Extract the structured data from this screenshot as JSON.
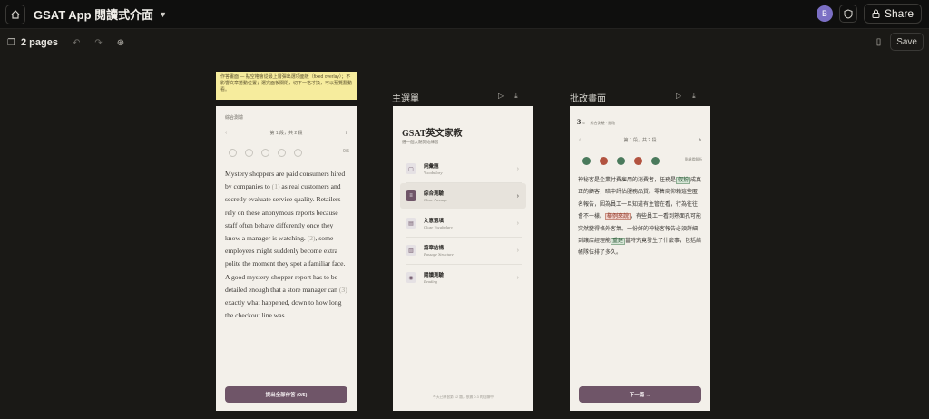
{
  "topbar": {
    "app_title": "GSAT App 閱讀式介面",
    "avatar_initial": "B",
    "share_label": "Share"
  },
  "toolbar": {
    "pages_label": "2 pages",
    "save_label": "Save"
  },
  "sticky_note": {
    "text": "作答畫面 — 點空格會從最上層彈出選項面板（fixed overlay）；不影響文章捲動位置；選完面板關閉，切下一格才換，可以預覽翻動看。"
  },
  "frames": [
    {
      "label": "主選單"
    },
    {
      "label": "批改畫面"
    }
  ],
  "answer_screen": {
    "top_label": "綜合測驗",
    "pager_text": "第 1 段，共 2 段",
    "score": "0/5",
    "passage": [
      {
        "t": "Mystery shoppers are paid consumers hired by companies to "
      },
      {
        "t": "(1)",
        "blank": true
      },
      {
        "t": " as real customers and secretly evaluate service quality. Retailers rely on these anonymous reports because staff often behave differently once they know a manager is watching. "
      },
      {
        "t": "(2)",
        "blank": true
      },
      {
        "t": ", some employees might suddenly become extra polite the moment they spot a familiar face. A good mystery-shopper report has to be detailed enough that a store manager can "
      },
      {
        "t": "(3)",
        "blank": true
      },
      {
        "t": " exactly what happened, down to how long the checkout line was."
      }
    ],
    "submit_label": "提出全部作答 (0/5)"
  },
  "menu_screen": {
    "title": "GSAT英文家教",
    "subtitle": "選一個大題開始練習",
    "items": [
      {
        "icon": "book-icon",
        "label": "詞彙題",
        "sub": "Vocabulary"
      },
      {
        "icon": "lines-icon",
        "label": "綜合測驗",
        "sub": "Cloze Passage"
      },
      {
        "icon": "box-icon",
        "label": "文意選填",
        "sub": "Cloze Vocabulary"
      },
      {
        "icon": "layout-icon",
        "label": "篇章結構",
        "sub": "Passage Structure"
      },
      {
        "icon": "eye-icon",
        "label": "閱讀測驗",
        "sub": "Reading"
      }
    ],
    "footer": "今天已練習第 12 題，依據 0.3 的回饋中"
  },
  "review_screen": {
    "question_num": "3",
    "question_of": "/5",
    "meta": "綜合測驗 · 批改",
    "pager_text": "第 1 段，共 2 段",
    "note": "點擊看解析",
    "dot_colors": [
      "#4a7a5c",
      "#b25340",
      "#4a7a5c",
      "#b25340",
      "#4a7a5c"
    ],
    "passage": [
      {
        "t": "神秘客是企業付費雇用的消費者，任務是"
      },
      {
        "t": "假扮",
        "hl": "g"
      },
      {
        "t": "成真正的顧客，暗中評估服務品質。零售商仰賴這些匿名報告，因為員工一旦知道有主管在看，行為往往會不一樣。"
      },
      {
        "t": "舉例來說",
        "hl": "r"
      },
      {
        "t": "，有些員工一看到熟面孔可能突然變得格外客氣。一份好的神秘客報告必須詳細到讓店經理能"
      },
      {
        "t": "重建",
        "hl": "g"
      },
      {
        "t": "當時究竟發生了什麼事，包括結帳隊伍排了多久。"
      }
    ],
    "next_label": "下一篇 →"
  }
}
